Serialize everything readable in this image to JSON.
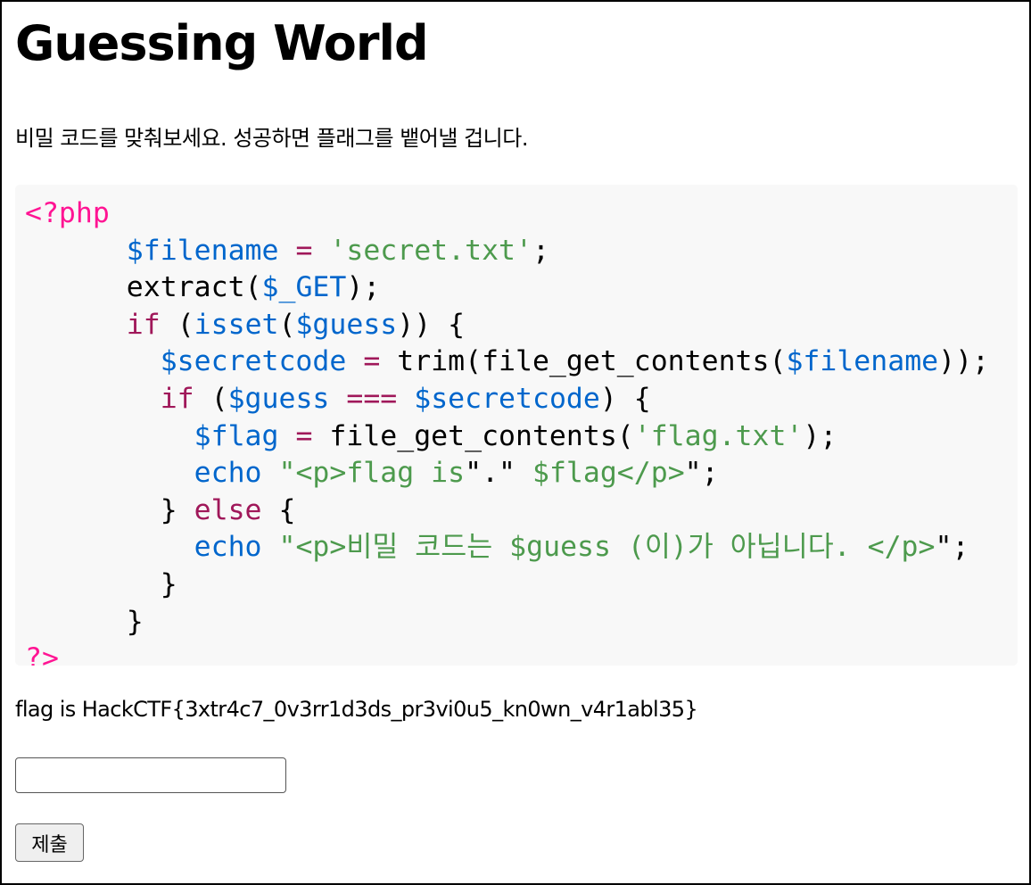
{
  "page": {
    "title": "Guessing World",
    "description": "비밀 코드를 맞춰보세요. 성공하면 플래그를 뱉어낼 겁니다."
  },
  "code": {
    "language": "php",
    "lines": [
      "<?php",
      "      $filename = 'secret.txt';",
      "      extract($_GET);",
      "      if (isset($guess)) {",
      "        $secretcode = trim(file_get_contents($filename));",
      "        if ($guess === $secretcode) {",
      "          $flag = file_get_contents('flag.txt');",
      "          echo \"<p>flag is\".\" $flag</p>\";",
      "        } else {",
      "          echo \"<p>비밀 코드는 $guess (이)가 아닙니다. </p>\";",
      "        }",
      "      }",
      "?>"
    ]
  },
  "result": {
    "text": "flag is HackCTF{3xtr4c7_0v3rr1d3ds_pr3vi0u5_kn0wn_v4r1abl35}"
  },
  "form": {
    "guess_value": "",
    "submit_label": "제출"
  },
  "colors": {
    "php_tag": "#ff1493",
    "variable": "#0066cc",
    "keyword": "#a0185a",
    "string": "#4d9a4d",
    "code_background": "#f8f8f8"
  }
}
